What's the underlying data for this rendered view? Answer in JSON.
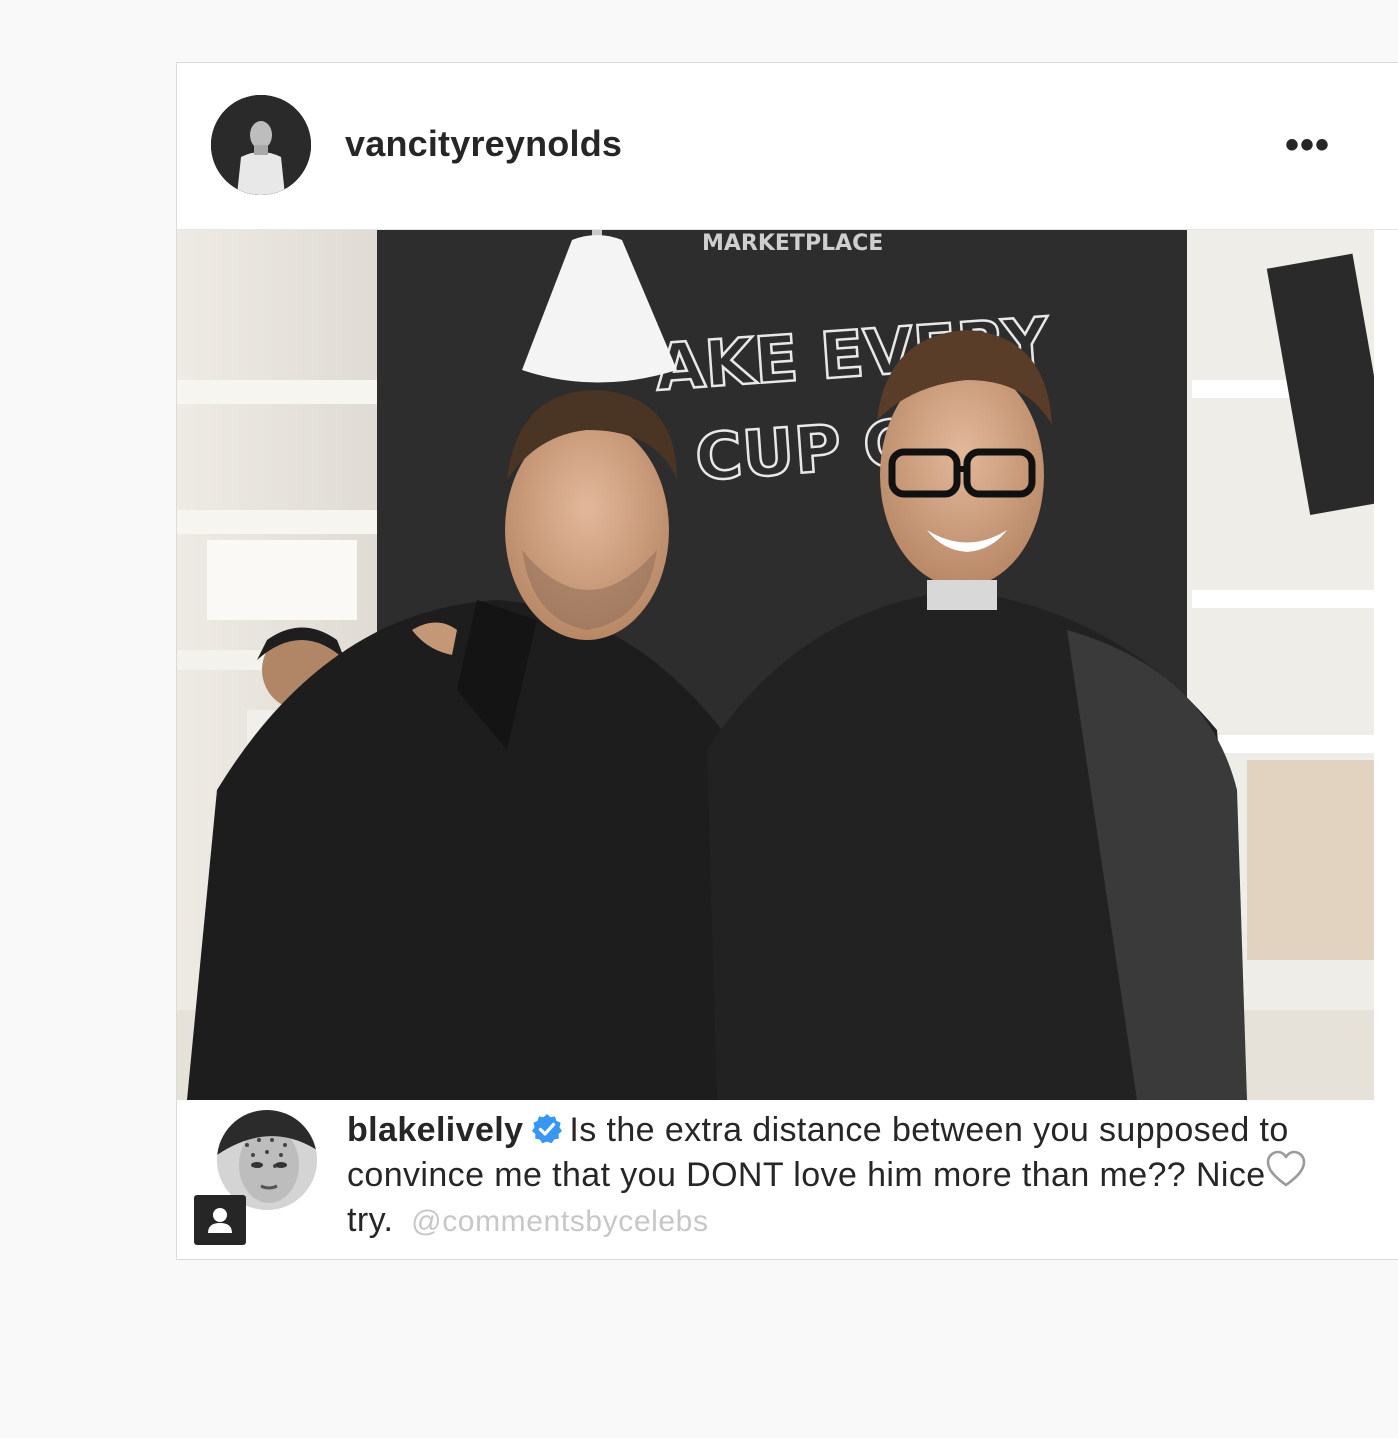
{
  "post": {
    "username": "vancityreynolds",
    "more_icon": "•••",
    "photo_sign_top": "MARKETPLACE",
    "photo_sign_line1": "AKE EVERY",
    "photo_sign_line2": "CUP  C"
  },
  "comment": {
    "username": "blakelively",
    "verified_icon": "verified-badge-icon",
    "text": "Is the extra distance between you supposed to convince me that you DONT love him more than me?? Nice try.",
    "watermark": "@commentsbycelebs"
  },
  "colors": {
    "verified_blue": "#3897f0",
    "text_primary": "#262626",
    "watermark": "#c7c7c7",
    "border": "#dbdbdb"
  }
}
